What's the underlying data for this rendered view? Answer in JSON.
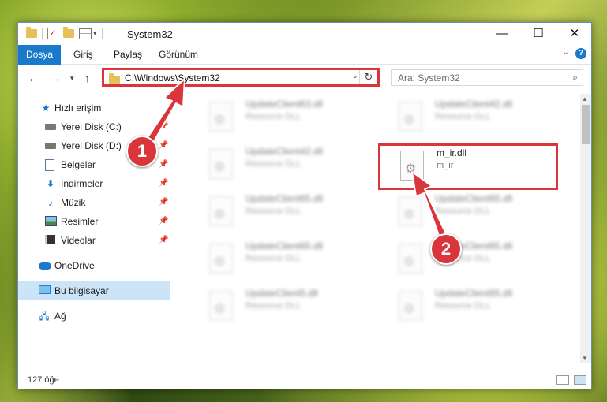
{
  "titlebar": {
    "title": "System32",
    "minimize": "—",
    "maximize": "☐",
    "close": "✕"
  },
  "ribbon": {
    "tabs": [
      "Dosya",
      "Giriş",
      "Paylaş",
      "Görünüm"
    ],
    "help": "?"
  },
  "address": {
    "path": "C:\\Windows\\System32",
    "search_placeholder": "Ara: System32"
  },
  "sidebar": {
    "items": [
      {
        "label": "Hızlı erişim",
        "icon": "star-icon"
      },
      {
        "label": "Yerel Disk (C:)",
        "icon": "drive-icon",
        "pinned": true
      },
      {
        "label": "Yerel Disk (D:)",
        "icon": "drive-icon",
        "pinned": true
      },
      {
        "label": "Belgeler",
        "icon": "document-icon",
        "pinned": true
      },
      {
        "label": "İndirmeler",
        "icon": "download-icon",
        "pinned": true
      },
      {
        "label": "Müzik",
        "icon": "music-icon",
        "pinned": true
      },
      {
        "label": "Resimler",
        "icon": "pictures-icon",
        "pinned": true
      },
      {
        "label": "Videolar",
        "icon": "videos-icon",
        "pinned": true
      },
      {
        "label": "OneDrive",
        "icon": "onedrive-icon"
      },
      {
        "label": "Bu bilgisayar",
        "icon": "this-pc-icon",
        "selected": true
      },
      {
        "label": "Ağ",
        "icon": "network-icon"
      }
    ]
  },
  "files": {
    "left": [
      {
        "name": "UpdateClient63.dll",
        "desc": "Resource DLL"
      },
      {
        "name": "UpdateClient42.dll",
        "desc": "Resource DLL"
      },
      {
        "name": "UpdateClient65.dll",
        "desc": "Resource DLL"
      },
      {
        "name": "UpdateClient65.dll",
        "desc": "Resource DLL"
      },
      {
        "name": "UpdateClient5.dll",
        "desc": "Resource DLL"
      }
    ],
    "right": [
      {
        "name": "UpdateClient42.dll",
        "desc": "Resource DLL"
      },
      {
        "name": "m_ir.dll",
        "desc": "m_ir"
      },
      {
        "name": "UpdateClient65.dll",
        "desc": "Resource DLL"
      },
      {
        "name": "UpdateClient65.dll",
        "desc": "Resource DLL"
      },
      {
        "name": "UpdateClient65.dll",
        "desc": "Resource DLL"
      }
    ]
  },
  "status": {
    "count": "127 öğe"
  },
  "annotations": {
    "step1": "1",
    "step2": "2",
    "color": "#d9353a"
  }
}
